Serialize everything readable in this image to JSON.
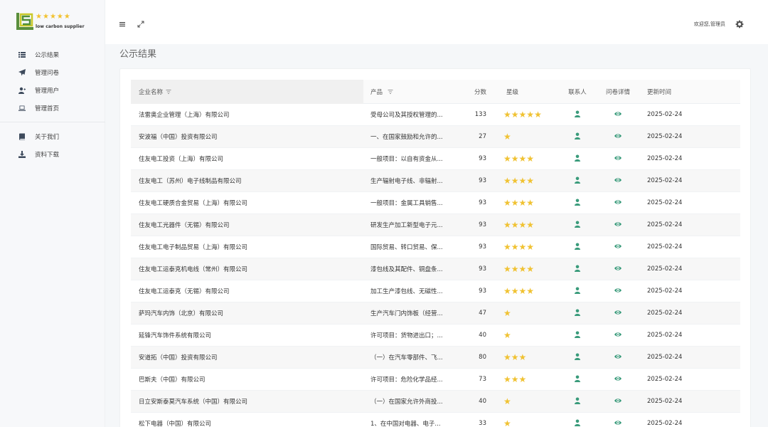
{
  "app": {
    "logo_text": "low carbon supplier",
    "logo_stars": 5,
    "welcome": "欢迎您,管理员"
  },
  "sidebar": {
    "group1": [
      {
        "label": "公示结果",
        "icon": "list-icon"
      },
      {
        "label": "管理问卷",
        "icon": "paper-plane-icon"
      },
      {
        "label": "管理用户",
        "icon": "add-user-icon"
      },
      {
        "label": "管理首页",
        "icon": "laptop-icon"
      }
    ],
    "group2": [
      {
        "label": "关于我们",
        "icon": "book-icon"
      },
      {
        "label": "资料下载",
        "icon": "download-icon"
      }
    ]
  },
  "main": {
    "title": "公示结果"
  },
  "table": {
    "headers": {
      "company": "企业名称",
      "product": "产品",
      "score": "分数",
      "stars": "星级",
      "contact": "联系人",
      "detail": "问卷详情",
      "updated": "更新时间"
    },
    "rows": [
      {
        "company": "法雷奥企业管理（上海）有限公司",
        "product": "受母公司及其授权管理的...",
        "score": "133",
        "stars": 5,
        "updated": "2025-02-24"
      },
      {
        "company": "安波福（中国）投资有限公司",
        "product": "一、在国家鼓励和允许的...",
        "score": "27",
        "stars": 1,
        "updated": "2025-02-24"
      },
      {
        "company": "住友电工投资（上海）有限公司",
        "product": "一般项目：以自有资金从...",
        "score": "93",
        "stars": 4,
        "updated": "2025-02-24"
      },
      {
        "company": "住友电工（苏州）电子线制品有限公司",
        "product": "生产辐射电子线、非辐射...",
        "score": "93",
        "stars": 4,
        "updated": "2025-02-24"
      },
      {
        "company": "住友电工硬质合金贸易（上海）有限公司",
        "product": "一般项目：金属工具销售...",
        "score": "93",
        "stars": 4,
        "updated": "2025-02-24"
      },
      {
        "company": "住友电工光器件（无锡）有限公司",
        "product": "研发生产加工新型电子元...",
        "score": "93",
        "stars": 4,
        "updated": "2025-02-24"
      },
      {
        "company": "住友电工电子制品贸易（上海）有限公司",
        "product": "国际贸易、转口贸易、保...",
        "score": "93",
        "stars": 4,
        "updated": "2025-02-24"
      },
      {
        "company": "住友电工运泰克机电线（常州）有限公司",
        "product": "漆包线及其配件、铜盘条...",
        "score": "93",
        "stars": 4,
        "updated": "2025-02-24"
      },
      {
        "company": "住友电工运泰克（无锡）有限公司",
        "product": "加工生产漆包线、无磁性...",
        "score": "93",
        "stars": 4,
        "updated": "2025-02-24"
      },
      {
        "company": "萨玛汽车内饰（北京）有限公司",
        "product": "生产汽车门内饰板（经营...",
        "score": "47",
        "stars": 1,
        "updated": "2025-02-24"
      },
      {
        "company": "延锋汽车饰件系统有限公司",
        "product": "许可项目：货物进出口；...",
        "score": "40",
        "stars": 1,
        "updated": "2025-02-24"
      },
      {
        "company": "安道拓（中国）投资有限公司",
        "product": "（一）在汽车零部件、飞...",
        "score": "80",
        "stars": 3,
        "updated": "2025-02-24"
      },
      {
        "company": "巴斯夫（中国）有限公司",
        "product": "许可项目：危险化学品经...",
        "score": "73",
        "stars": 3,
        "updated": "2025-02-24"
      },
      {
        "company": "日立安斯泰莫汽车系统（中国）有限公司",
        "product": "（一）在国家允许外商投...",
        "score": "40",
        "stars": 1,
        "updated": "2025-02-24"
      },
      {
        "company": "松下电器（中国）有限公司",
        "product": "1、在中国对电器、电子...",
        "score": "33",
        "stars": 1,
        "updated": "2025-02-24"
      }
    ]
  },
  "colors": {
    "star": "#f0c232",
    "accent_green": "#3a9b7b",
    "logo_green": "#4a8a3a",
    "logo_yellow": "#d4c62a"
  }
}
